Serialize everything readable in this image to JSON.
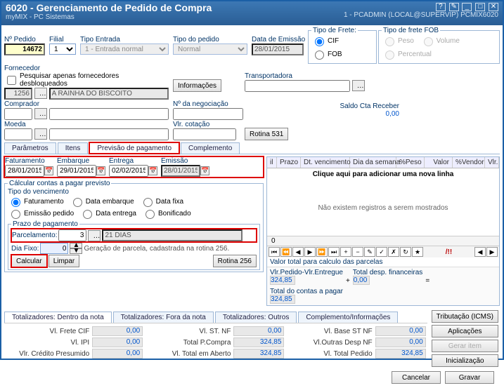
{
  "title": {
    "main": "6020 - Gerenciamento de Pedido de Compra",
    "sub": "myMIX - PC Sistemas",
    "context": "1 - PCADMIN (LOCAL@SUPERVIP)   PCMIX6020"
  },
  "header": {
    "nPedido_label": "Nº Pedido",
    "nPedido": "14672",
    "filial_label": "Filial",
    "filial": "1",
    "tipoEntrada_label": "Tipo Entrada",
    "tipoEntrada": "1 - Entrada normal",
    "tipoPedido_label": "Tipo do pedido",
    "tipoPedido": "Normal",
    "dataEmissao_label": "Data de Emissão",
    "dataEmissao": "28/01/2015",
    "tipoFrete_label": "Tipo de Frete:",
    "tipoFrete_cif": "CIF",
    "tipoFrete_fob": "FOB",
    "tipoFreteFOB_label": "Tipo de frete FOB",
    "fob_peso": "Peso",
    "fob_volume": "Volume",
    "fob_percent": "Percentual",
    "fornecedor_label": "Fornecedor",
    "fornecedor_cod": "1256",
    "fornecedor_nome": "A RAINHA DO BISCOITO",
    "pesquisar": "Pesquisar apenas fornecedores desbloqueados",
    "informacoes": "Informações",
    "transportadora_label": "Transportadora",
    "comprador_label": "Comprador",
    "nNegociacao_label": "Nº da negociação",
    "saldoCta_label": "Saldo Cta Receber",
    "saldoCta": "0,00",
    "moeda_label": "Moeda",
    "vlrCotacao_label": "Vlr. cotação",
    "rotina531": "Rotina 531"
  },
  "tabs": {
    "parametros": "Parâmetros",
    "itens": "Itens",
    "previsao": "Previsão de pagamento",
    "complemento": "Complemento"
  },
  "dates": {
    "faturamento_label": "Faturamento",
    "faturamento": "28/01/2015",
    "embarque_label": "Embarque",
    "embarque": "29/01/2015",
    "entrega_label": "Entrega",
    "entrega": "02/02/2015",
    "emissao_label": "Emissão",
    "emissao": "28/01/2015"
  },
  "calc": {
    "groupTitle": "Cálcular contas a pagar previsto",
    "tipoVenc_label": "Tipo do vencimento",
    "opt_faturamento": "Faturamento",
    "opt_dataEmbarque": "Data embarque",
    "opt_dataFixa": "Data fixa",
    "opt_emissaoPedido": "Emissão pedido",
    "opt_dataEntrega": "Data entrega",
    "opt_bonificado": "Bonificado",
    "prazo_label": "Prazo de pagamento",
    "parcelamento_label": "Parcelamento:",
    "parcelamento": "3",
    "parcelamentoDesc": "21 DIAS",
    "diaFixo_label": "Dia Fixo:",
    "diaFixo": "0",
    "geracaoNote": "Geração de parcela, cadastrada na rotina 256.",
    "calcular": "Calcular",
    "limpar": "Limpar",
    "rotina256": "Rotina 256"
  },
  "grid": {
    "col_il": "il",
    "col_prazo": "Prazo",
    "col_dtvenc": "Dt. vencimento",
    "col_diasemana": "Dia da semana",
    "col_peso": "%Peso",
    "col_valor": "Valor",
    "col_vendor": "%Vendor",
    "col_vlr": "Vlr.",
    "hint": "Clique aqui para adicionar uma nova linha",
    "empty": "Não existem registros a serem mostrados",
    "count": "0",
    "reccount": "/!!",
    "totalsTitle": "Valor total para calculo das parcelas",
    "lbl_vlrPedidoEntregue": "Vlr.Pedido-Vlr.Entregue",
    "lbl_totalDesp": "Total desp. financeiras",
    "lbl_totalContas": "Total do contas a pagar",
    "v1": "324,85",
    "plus": "+",
    "v2": "0,00",
    "eq": "=",
    "v3": "324,85"
  },
  "totalsTabs": {
    "dentro": "Totalizadores: Dentro da nota",
    "fora": "Totalizadores: Fora da nota",
    "outros": "Totalizadores: Outros",
    "compl": "Complemento/Informações"
  },
  "totals": {
    "vlFreteCIF_label": "Vl. Frete CIF",
    "vlFreteCIF": "0,00",
    "vlIPI_label": "Vl. IPI",
    "vlIPI": "0,00",
    "vlrCredPres_label": "Vlr. Crédito Presumido",
    "vlrCredPres": "0,00",
    "vlSTNF_label": "Vl. ST. NF",
    "vlSTNF": "0,00",
    "totalPCompra_label": "Total P.Compra",
    "totalPCompra": "324,85",
    "vlTotalAberto_label": "Vl. Total em Aberto",
    "vlTotalAberto": "324,85",
    "vlBaseST_label": "Vl. Base ST NF",
    "vlBaseST": "0,00",
    "vlOutrasDesp_label": "Vl.Outras Desp NF",
    "vlOutrasDesp": "0,00",
    "vlTotalPedido_label": "Vl. Total  Pedido",
    "vlTotalPedido": "324,85"
  },
  "sideButtons": {
    "tributacao": "Tributação (ICMS)",
    "aplicacoes": "Aplicações",
    "gerarItem": "Gerar item",
    "inicializacao": "Inicialização"
  },
  "footer": {
    "cancelar": "Cancelar",
    "gravar": "Gravar"
  }
}
